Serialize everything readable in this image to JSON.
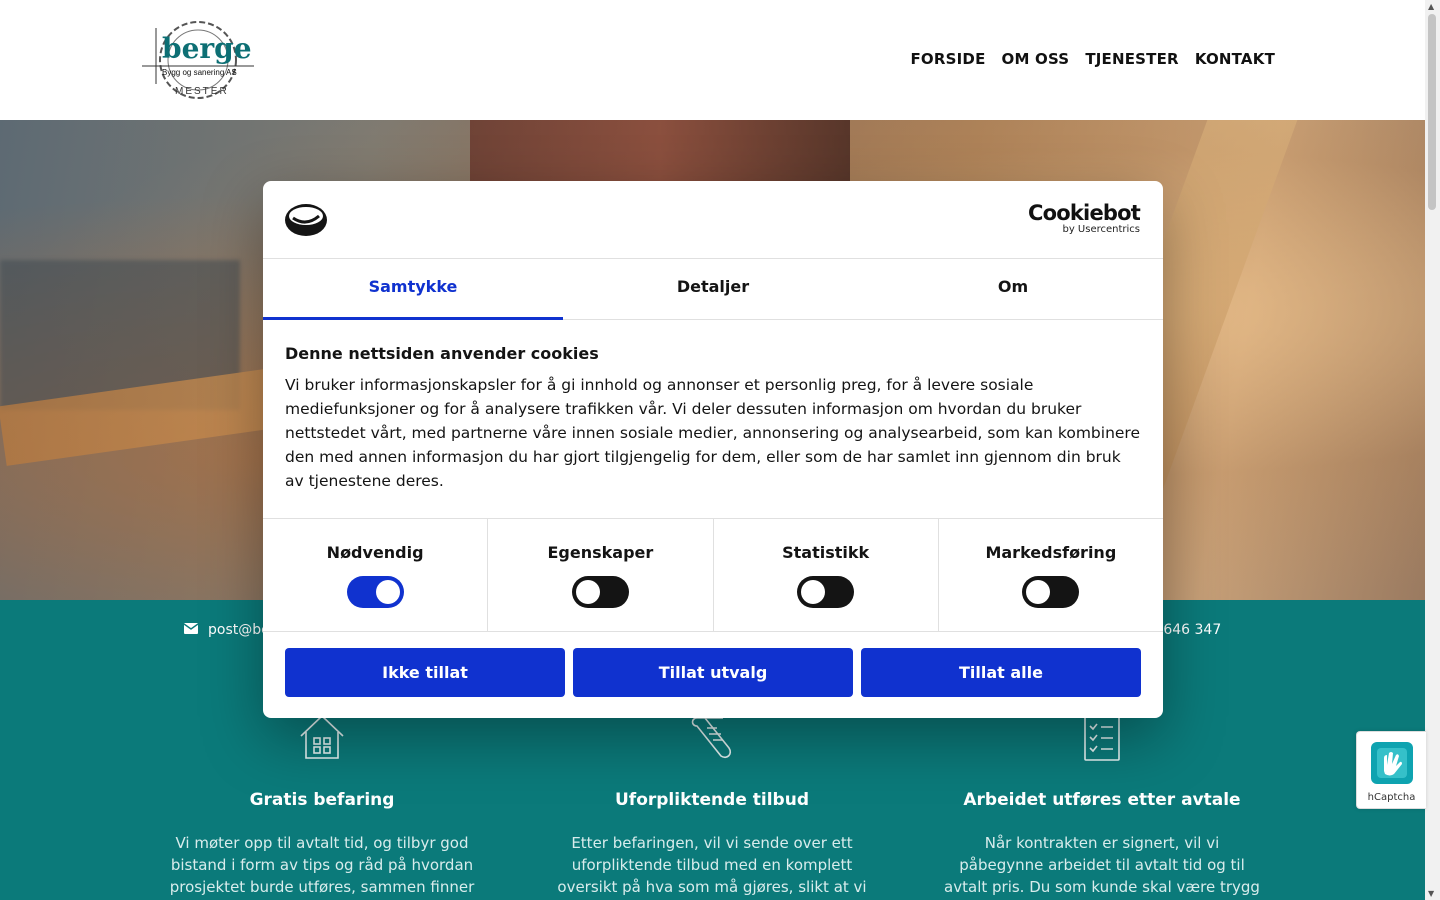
{
  "nav": {
    "items": [
      "FORSIDE",
      "OM OSS",
      "TJENESTER",
      "KONTAKT"
    ]
  },
  "logo": {
    "brand": "berge",
    "tagline": "Bygg og sanering AS",
    "sub": "MESTER"
  },
  "contact": {
    "email_partial": "post@be",
    "phone_partial": "9 646 347"
  },
  "features": [
    {
      "icon": "house-icon",
      "title": "Gratis befaring",
      "text": "Vi møter opp til avtalt tid, og tilbyr god bistand i form av tips og råd på hvordan prosjektet burde utføres, sammen finner vi"
    },
    {
      "icon": "scroll-icon",
      "title": "Uforpliktende tilbud",
      "text": "Etter befaringen, vil vi sende over ett uforpliktende tilbud med en komplett oversikt på hva som må gjøres, slikt at vi"
    },
    {
      "icon": "checklist-icon",
      "title": "Arbeidet utføres etter avtale",
      "text": "Når kontrakten er signert, vil vi påbegynne arbeidet til avtalt tid og til avtalt pris. Du som kunde skal være trygg på valget, og vi holder"
    }
  ],
  "cookie": {
    "brand": "Cookiebot",
    "brand_sub": "by Usercentrics",
    "tabs": [
      "Samtykke",
      "Detaljer",
      "Om"
    ],
    "heading": "Denne nettsiden anvender cookies",
    "body": "Vi bruker informasjonskapsler for å gi innhold og annonser et personlig preg, for å levere sosiale mediefunksjoner og for å analysere trafikken vår. Vi deler dessuten informasjon om hvordan du bruker nettstedet vårt, med partnerne våre innen sosiale medier, annonsering og analysearbeid, som kan kombinere den med annen informasjon du har gjort tilgjengelig for dem, eller som de har samlet inn gjennom din bruk av tjenestene deres.",
    "toggles": [
      {
        "label": "Nødvendig",
        "on": true
      },
      {
        "label": "Egenskaper",
        "on": false
      },
      {
        "label": "Statistikk",
        "on": false
      },
      {
        "label": "Markedsføring",
        "on": false
      }
    ],
    "buttons": [
      "Ikke tillat",
      "Tillat utvalg",
      "Tillat alle"
    ],
    "accent": "#1032cf"
  },
  "hcaptcha": {
    "label": "hCaptcha"
  },
  "colors": {
    "teal": "#0b7a7a",
    "text": "#141414"
  }
}
